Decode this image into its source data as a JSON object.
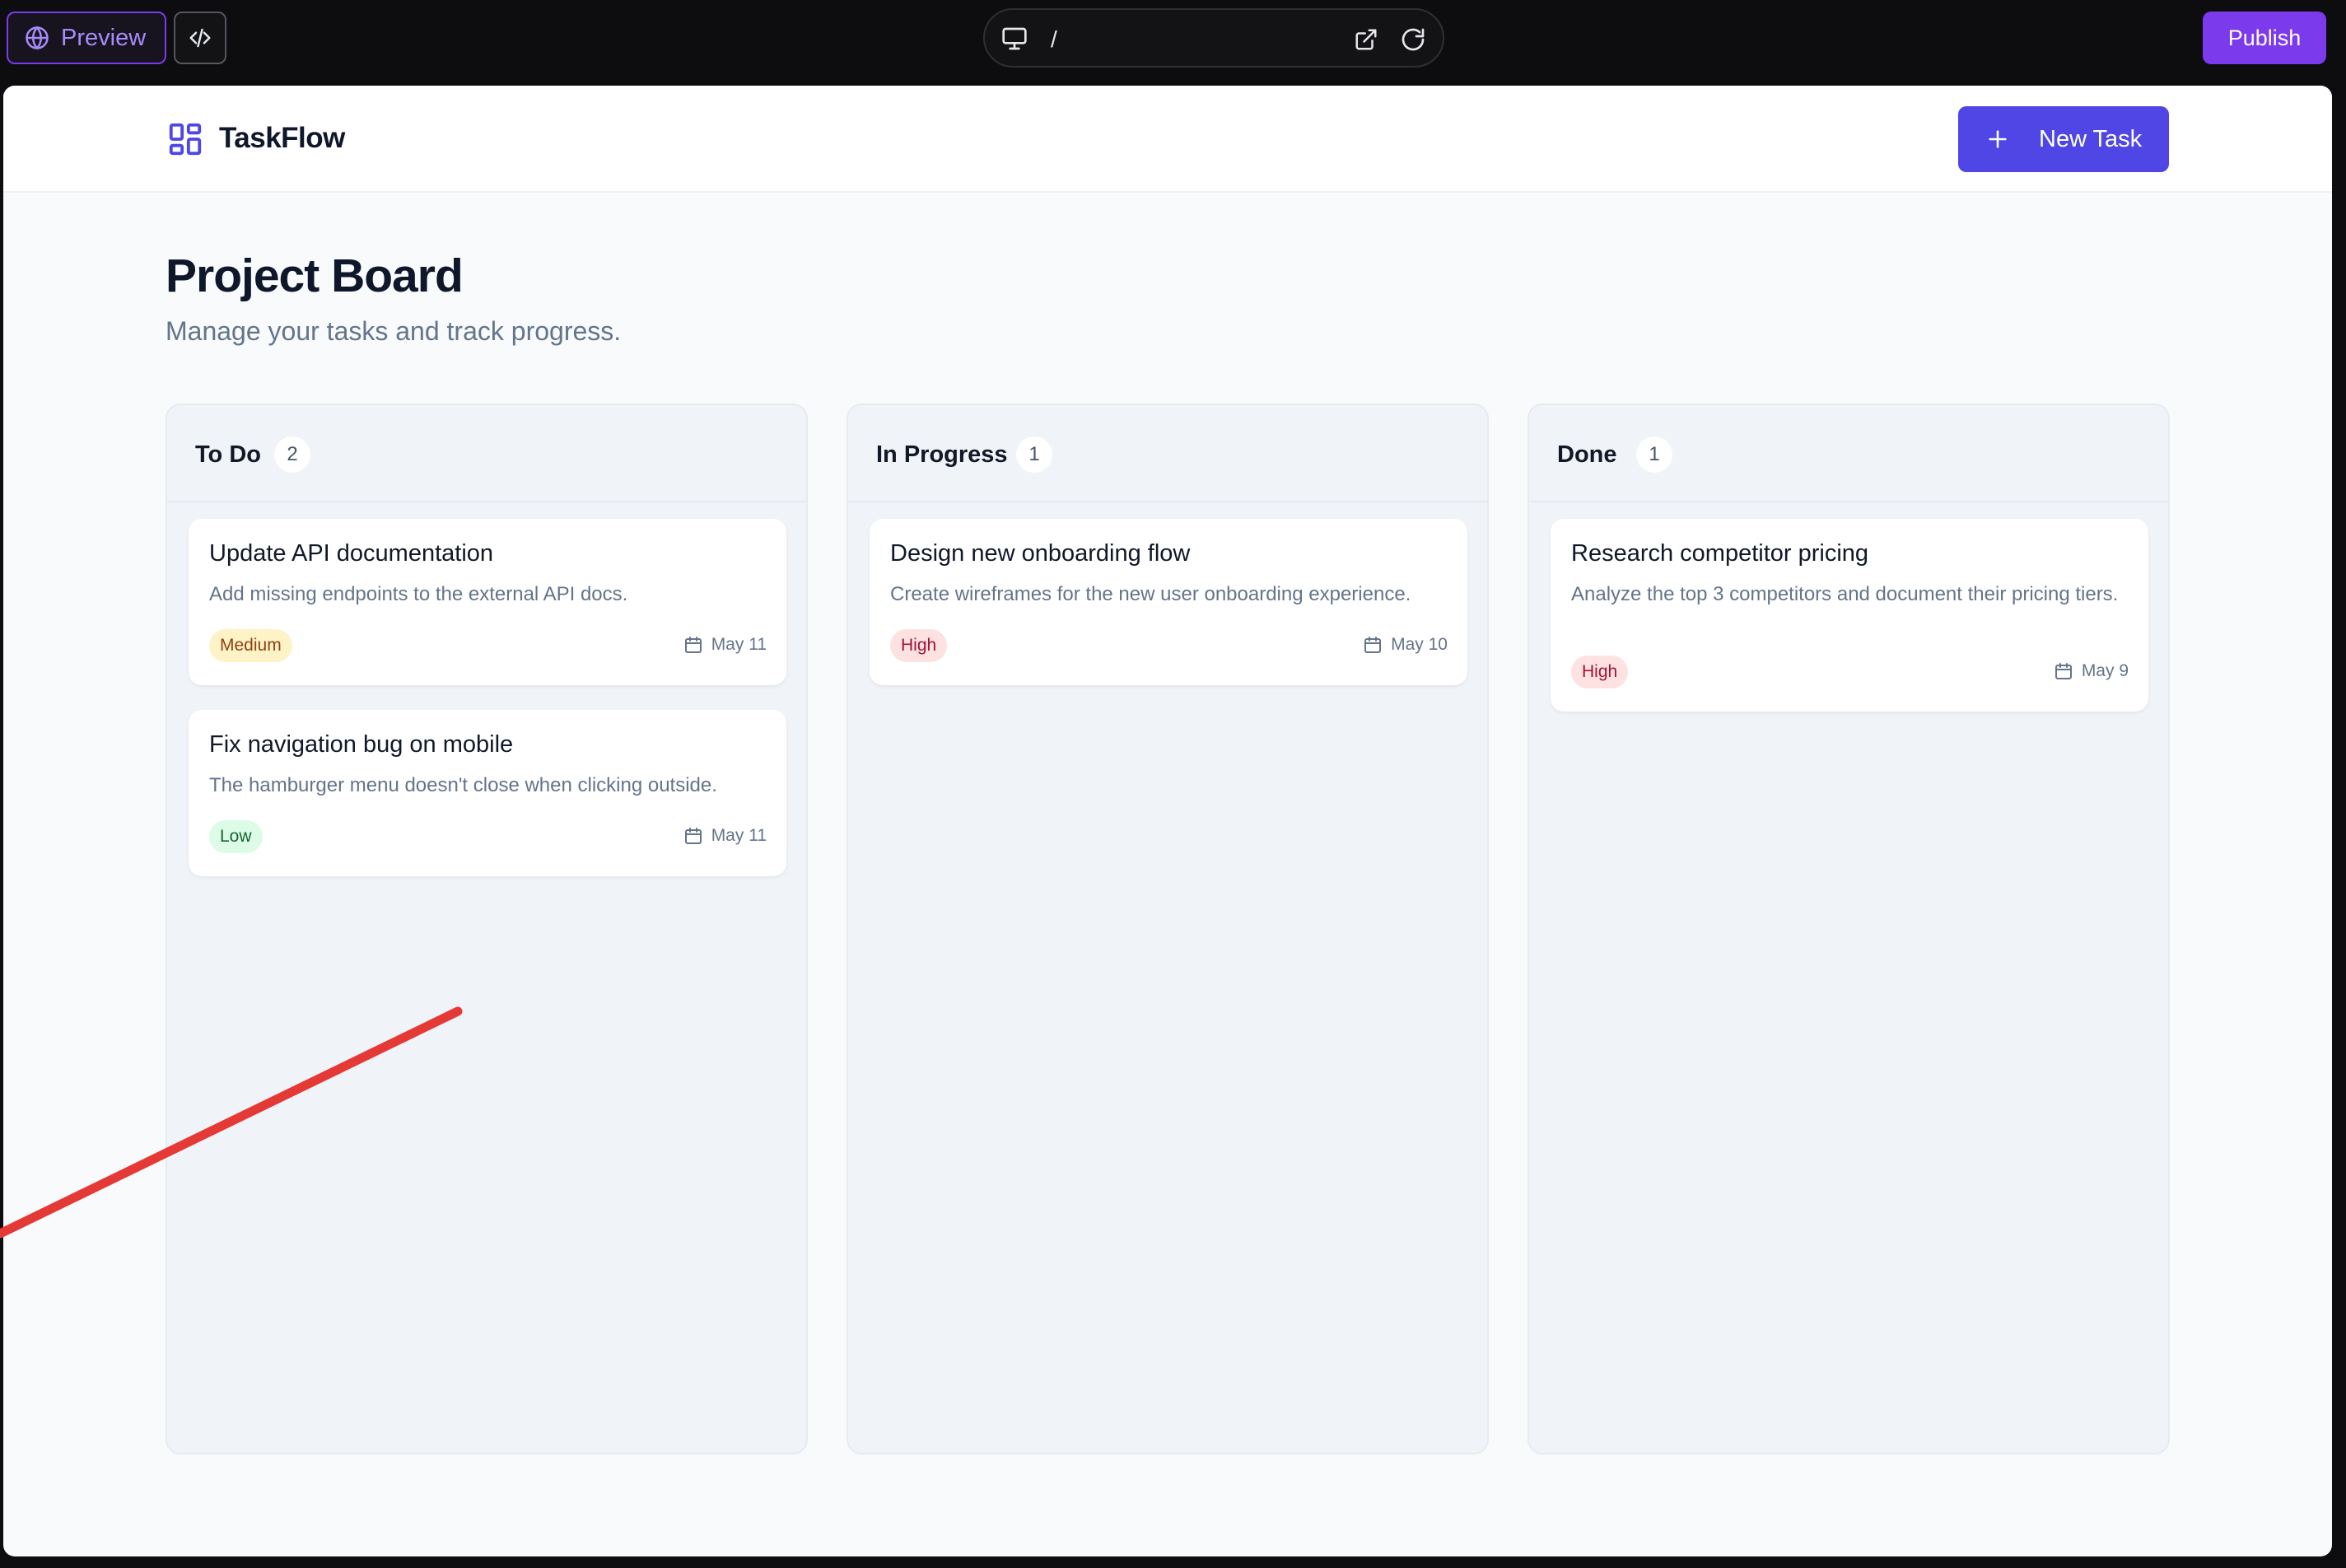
{
  "editor": {
    "preview_label": "Preview",
    "path": "/",
    "publish_label": "Publish"
  },
  "app": {
    "brand": "TaskFlow",
    "new_task_label": "New Task",
    "page_title": "Project Board",
    "page_subtitle": "Manage your tasks and track progress."
  },
  "columns": [
    {
      "title": "To Do",
      "count": "2",
      "cards": [
        {
          "title": "Update API documentation",
          "description": "Add missing endpoints to the external API docs.",
          "priority": "Medium",
          "date": "May 11"
        },
        {
          "title": "Fix navigation bug on mobile",
          "description": "The hamburger menu doesn't close when clicking outside.",
          "priority": "Low",
          "date": "May 11"
        }
      ]
    },
    {
      "title": "In Progress",
      "count": "1",
      "cards": [
        {
          "title": "Design new onboarding flow",
          "description": "Create wireframes for the new user onboarding experience.",
          "priority": "High",
          "date": "May 10"
        }
      ]
    },
    {
      "title": "Done",
      "count": "1",
      "cards": [
        {
          "title": "Research competitor pricing",
          "description": "Analyze the top 3 competitors and document their pricing tiers.",
          "priority": "High",
          "date": "May 9"
        }
      ]
    }
  ],
  "colors": {
    "accent": "#7c3aed",
    "primary": "#4f46e5",
    "annotation_arrow": "#e53935"
  },
  "icons": {
    "preview": "globe-icon",
    "code": "code-icon",
    "url": "monitor-icon",
    "open_external": "external-link-icon",
    "reload": "refresh-icon",
    "logo": "grid-layout-icon",
    "new_task": "plus-icon",
    "date": "calendar-icon"
  }
}
